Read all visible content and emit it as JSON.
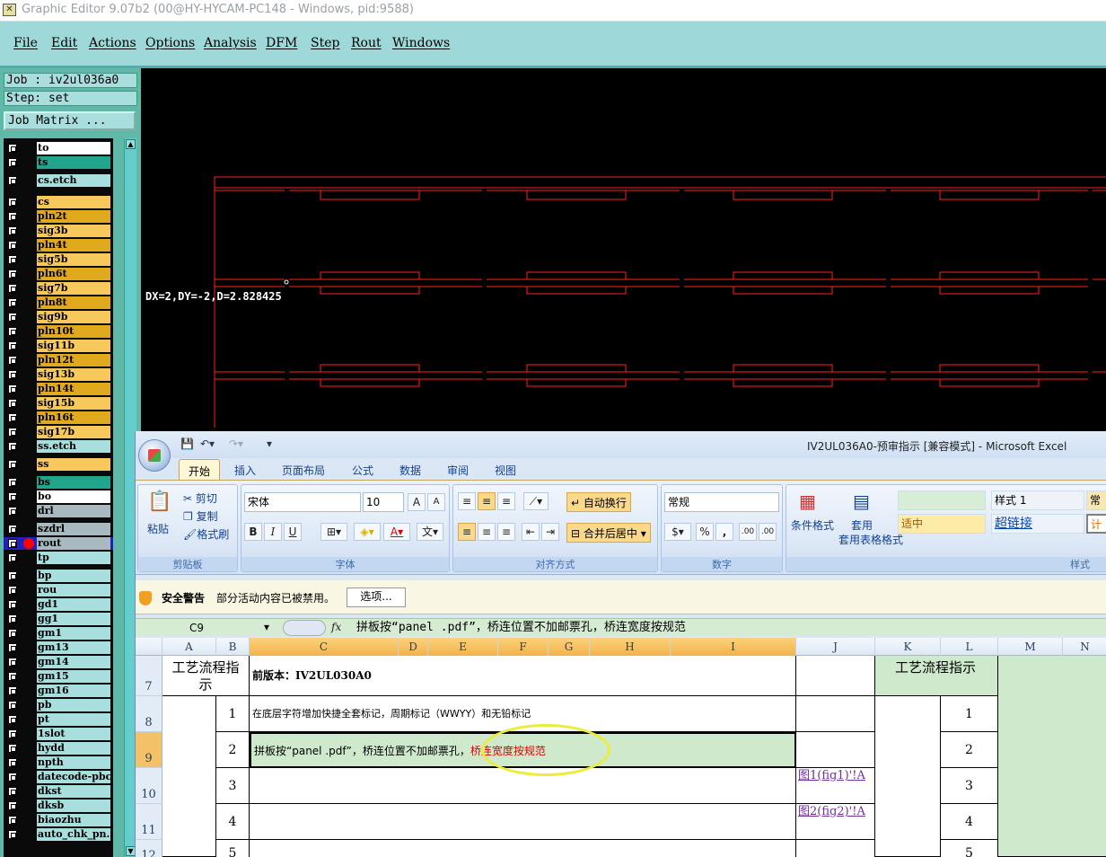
{
  "window": {
    "title": "Graphic Editor 9.07b2 (00@HY-HYCAM-PC148 - Windows, pid:9588)"
  },
  "menu": [
    "File",
    "Edit",
    "Actions",
    "Options",
    "Analysis",
    "DFM",
    "Step",
    "Rout",
    "Windows"
  ],
  "job": {
    "job_label": "Job : iv2ul036a0",
    "step_label": "Step: set",
    "matrix_button": "Job Matrix ..."
  },
  "layers": [
    {
      "name": "to",
      "color": "#ffffff"
    },
    {
      "name": "ts",
      "color": "#21a58d"
    },
    {
      "name": "cs.etch",
      "color": "#a8dede"
    },
    {
      "name": "cs",
      "color": "#f7c95c"
    },
    {
      "name": "pln2t",
      "color": "#e0a91e"
    },
    {
      "name": "sig3b",
      "color": "#f7c95c"
    },
    {
      "name": "pln4t",
      "color": "#e0a91e"
    },
    {
      "name": "sig5b",
      "color": "#f7c95c"
    },
    {
      "name": "pln6t",
      "color": "#e0a91e"
    },
    {
      "name": "sig7b",
      "color": "#f7c95c"
    },
    {
      "name": "pln8t",
      "color": "#e0a91e"
    },
    {
      "name": "sig9b",
      "color": "#f7c95c"
    },
    {
      "name": "pln10t",
      "color": "#e0a91e"
    },
    {
      "name": "sig11b",
      "color": "#f7c95c"
    },
    {
      "name": "pln12t",
      "color": "#e0a91e"
    },
    {
      "name": "sig13b",
      "color": "#f7c95c"
    },
    {
      "name": "pln14t",
      "color": "#e0a91e"
    },
    {
      "name": "sig15b",
      "color": "#f7c95c"
    },
    {
      "name": "pln16t",
      "color": "#e0a91e"
    },
    {
      "name": "sig17b",
      "color": "#f7c95c"
    },
    {
      "name": "ss.etch",
      "color": "#a8dede"
    },
    {
      "name": "ss",
      "color": "#f7c95c"
    },
    {
      "name": "bs",
      "color": "#21a58d"
    },
    {
      "name": "bo",
      "color": "#ffffff"
    },
    {
      "name": "drl",
      "color": "#a9b9c0"
    },
    {
      "name": "szdrl",
      "color": "#a9b9c0"
    },
    {
      "name": "rout",
      "color": "#a9b9c0"
    },
    {
      "name": "tp",
      "color": "#a8dede"
    },
    {
      "name": "bp",
      "color": "#a8dede"
    },
    {
      "name": "rou",
      "color": "#a8dede"
    },
    {
      "name": "gd1",
      "color": "#a8dede"
    },
    {
      "name": "gg1",
      "color": "#a8dede"
    },
    {
      "name": "gm1",
      "color": "#a8dede"
    },
    {
      "name": "gm13",
      "color": "#a8dede"
    },
    {
      "name": "gm14",
      "color": "#a8dede"
    },
    {
      "name": "gm15",
      "color": "#a8dede"
    },
    {
      "name": "gm16",
      "color": "#a8dede"
    },
    {
      "name": "pb",
      "color": "#a8dede"
    },
    {
      "name": "pt",
      "color": "#a8dede"
    },
    {
      "name": "1slot",
      "color": "#a8dede"
    },
    {
      "name": "hydd",
      "color": "#a8dede"
    },
    {
      "name": "npth",
      "color": "#a8dede"
    },
    {
      "name": "datecode-pbc",
      "color": "#a8dede"
    },
    {
      "name": "dkst",
      "color": "#a8dede"
    },
    {
      "name": "dksb",
      "color": "#a8dede"
    },
    {
      "name": "biaozhu",
      "color": "#a8dede"
    },
    {
      "name": "auto_chk_pn.",
      "color": "#a8dede"
    }
  ],
  "canvas": {
    "measure": "DX=2,DY=-2,D=2.828425"
  },
  "excel": {
    "title": "IV2UL036A0-预审指示  [兼容模式] - Microsoft Excel",
    "tabs": [
      "开始",
      "插入",
      "页面布局",
      "公式",
      "数据",
      "审阅",
      "视图"
    ],
    "ribbon": {
      "paste": "粘贴",
      "cut": "剪切",
      "copy": "复制",
      "format_painter": "格式刷",
      "clipboard": "剪贴板",
      "font_name": "宋体",
      "font_size": "10",
      "font_group": "字体",
      "bold": "B",
      "italic": "I",
      "underline": "U",
      "wrap_text": "自动换行",
      "merge_center": "合并后居中",
      "align_group": "对齐方式",
      "number_format": "常规",
      "percent": "%",
      "comma": ",",
      "dec_inc": ".00",
      "number_group": "数字",
      "cond_format": "条件格式",
      "table_format": "套用表格格式",
      "style_group": "样式",
      "style1": "样式 1",
      "medium": "适中",
      "hyperlink": "超链接",
      "normal": "常",
      "calc": "计"
    },
    "security": {
      "warning": "安全警告",
      "text": "部分活动内容已被禁用。",
      "options": "选项..."
    },
    "formula": {
      "name_box": "C9",
      "fx": "fx",
      "content": "拼板按“panel .pdf”，桥连位置不加邮票孔，桥连宽度按规范"
    },
    "columns": [
      "A",
      "B",
      "C",
      "D",
      "E",
      "F",
      "G",
      "H",
      "I",
      "J",
      "K",
      "L",
      "M",
      "N"
    ],
    "rows": [
      {
        "num": "7",
        "a": "工艺流程指示",
        "c": "前版本：IV2UL030A0",
        "k": "工艺流程指示"
      },
      {
        "num": "8",
        "b": "1",
        "c": "在底层字符增加快捷全套标记，周期标记（WWYY）和无铅标记",
        "l": "1"
      },
      {
        "num": "9",
        "b": "2",
        "c1": "拼板按“panel .pdf”，桥连位置不加邮票孔，",
        "c2": "桥连宽度按规范",
        "l": "2"
      },
      {
        "num": "10",
        "b": "3",
        "j": "图1(fig1)'!A",
        "l": "3"
      },
      {
        "num": "11",
        "b": "4",
        "j": "图2(fig2)'!A",
        "l": "4"
      },
      {
        "num": "12",
        "b": "5",
        "l": "5"
      }
    ]
  }
}
